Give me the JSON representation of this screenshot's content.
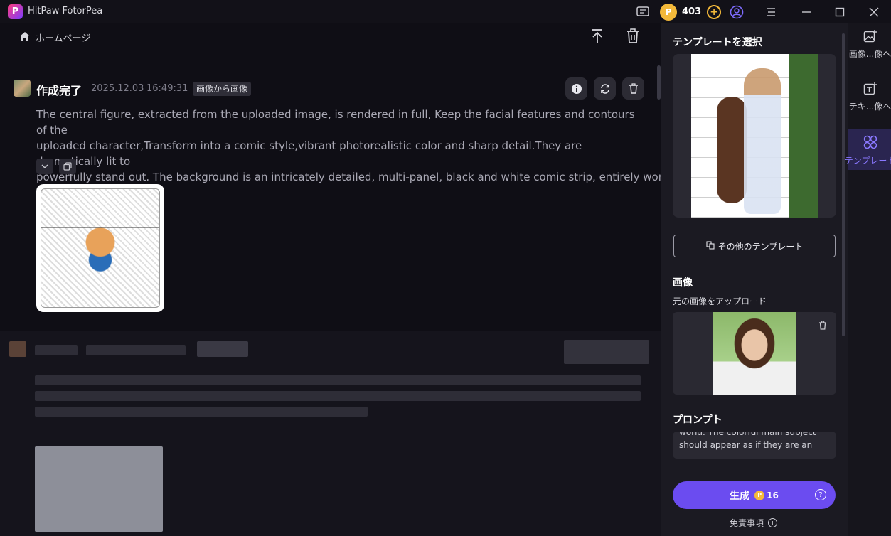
{
  "app": {
    "title": "HitPaw FotorPea"
  },
  "titlebar": {
    "coins": "403",
    "coin_symbol": "P",
    "add_symbol": "+"
  },
  "breadcrumb": {
    "home_label": "ホームページ"
  },
  "result": {
    "status": "作成完了",
    "date": "2025.12.03",
    "time": "16:49:31",
    "mode": "画像から画像",
    "prompt_line1": "The central figure, extracted from the uploaded image, is rendered in full, Keep the facial features and contours of the",
    "prompt_line2": "uploaded character,Transform into a comic style,vibrant photorealistic color and sharp detail.They are dramatically lit to",
    "prompt_line3": "powerfully stand out.    The background is an intricately detailed, multi-panel, black and white comic strip, entirely wordles..."
  },
  "panel": {
    "template_title": "テンプレートを選択",
    "more_templates": "その他のテンプレート",
    "image_title": "画像",
    "image_sub": "元の画像をアップロード",
    "prompt_title": "プロンプト",
    "prompt_line1": "world.    The colorful main subject",
    "prompt_line2": "should appear as if they are an",
    "generate_label": "生成",
    "generate_cost": "16",
    "help_symbol": "?",
    "disclaimer": "免責事項",
    "info_symbol": "i"
  },
  "sidenav": {
    "items": [
      {
        "label": "画像...像へ"
      },
      {
        "label": "テキ...像へ"
      },
      {
        "label": "テンプレート"
      }
    ]
  },
  "colors": {
    "accent": "#6b4cf0",
    "coin": "#f3b93a",
    "active_nav": "#8a78ff"
  }
}
